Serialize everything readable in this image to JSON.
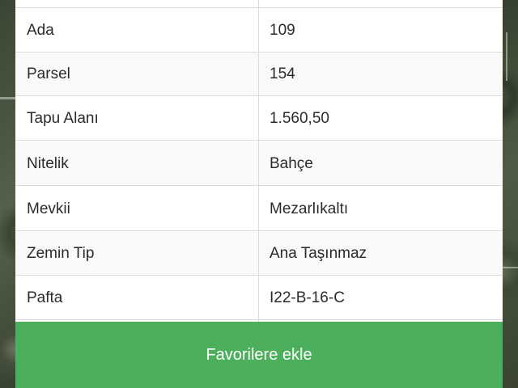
{
  "details": {
    "rows": [
      {
        "label": "Ada",
        "value": "109"
      },
      {
        "label": "Parsel",
        "value": "154"
      },
      {
        "label": "Tapu Alanı",
        "value": "1.560,50"
      },
      {
        "label": "Nitelik",
        "value": "Bahçe"
      },
      {
        "label": "Mevkii",
        "value": "Mezarlıkaltı"
      },
      {
        "label": "Zemin Tip",
        "value": "Ana Taşınmaz"
      },
      {
        "label": "Pafta",
        "value": "I22-B-16-C"
      }
    ]
  },
  "actions": {
    "favorite_label": "Favorilere ekle"
  },
  "colors": {
    "button_bg": "#4caf5c",
    "button_text": "#ffffff",
    "row_alt_bg": "#f9f9f9"
  }
}
